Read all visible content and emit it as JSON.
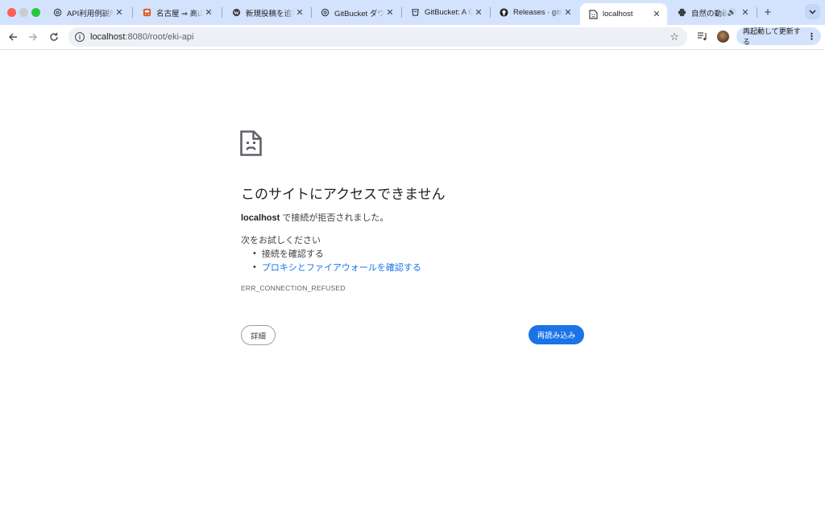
{
  "tabs": [
    {
      "title": "API利用例説明",
      "icon": "openai-icon",
      "active": false
    },
    {
      "title": "名古屋 ⇒ 高山, 特",
      "icon": "train-icon",
      "active": false
    },
    {
      "title": "新規投稿を追加 ‹",
      "icon": "wordpress-icon",
      "active": false
    },
    {
      "title": "GitBucket ダウ",
      "icon": "openai-icon",
      "active": false
    },
    {
      "title": "GitBucket: A Gi",
      "icon": "gitbucket-icon",
      "active": false
    },
    {
      "title": "Releases · gitbu",
      "icon": "github-icon",
      "active": false
    },
    {
      "title": "localhost",
      "icon": "broken-page-icon",
      "active": true
    },
    {
      "title": "自然の動画 | ",
      "icon": "youtube-icon",
      "active": false,
      "audio": true
    }
  ],
  "toolbar": {
    "url_host": "localhost",
    "url_rest": ":8080/root/eki-api",
    "relaunch_label": "再起動して更新する"
  },
  "error_page": {
    "title": "このサイトにアクセスできません",
    "host": "localhost",
    "message_suffix": " で接続が拒否されました。",
    "try_heading": "次をお試しください",
    "suggestions": [
      "接続を確認する",
      "プロキシとファイアウォールを確認する"
    ],
    "error_code": "ERR_CONNECTION_REFUSED",
    "details_button": "詳細",
    "reload_button": "再読み込み"
  },
  "colors": {
    "tabstrip_bg": "#d3e3fd",
    "primary_blue": "#1a73e8",
    "link_blue": "#1a73e8"
  }
}
